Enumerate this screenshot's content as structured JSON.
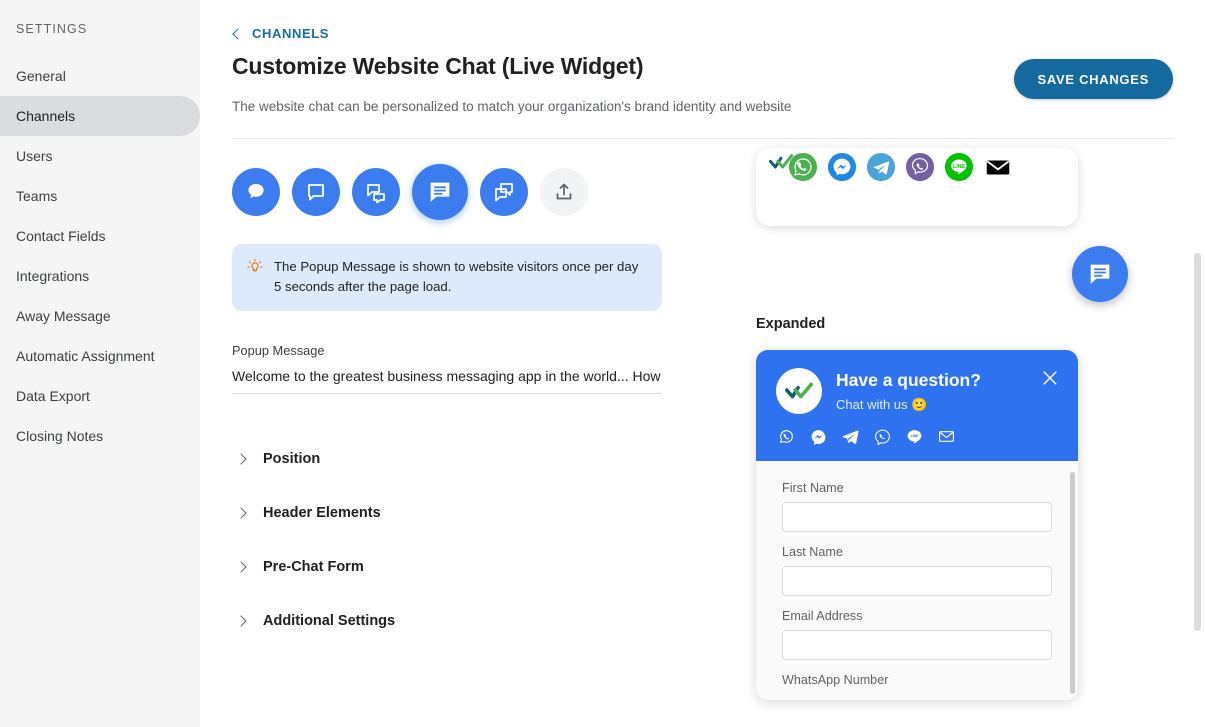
{
  "sidebar": {
    "title": "SETTINGS",
    "items": [
      {
        "label": "General",
        "active": false
      },
      {
        "label": "Channels",
        "active": true
      },
      {
        "label": "Users",
        "active": false
      },
      {
        "label": "Teams",
        "active": false
      },
      {
        "label": "Contact Fields",
        "active": false
      },
      {
        "label": "Integrations",
        "active": false
      },
      {
        "label": "Away Message",
        "active": false
      },
      {
        "label": "Automatic Assignment",
        "active": false
      },
      {
        "label": "Data Export",
        "active": false
      },
      {
        "label": "Closing Notes",
        "active": false
      }
    ]
  },
  "header": {
    "breadcrumb_label": "CHANNELS",
    "breadcrumb_icon": "chevron-left-icon",
    "title": "Customize Website Chat (Live Widget)",
    "subtitle": "The website chat can be personalized to match your organization's brand identity and website",
    "save_label": "SAVE CHANGES",
    "accent_color": "#14699f",
    "link_color": "#1a6e9e"
  },
  "icon_picker": {
    "options": [
      {
        "name": "chat-bubble-round-icon",
        "selected": false
      },
      {
        "name": "chat-bubble-square-icon",
        "selected": false
      },
      {
        "name": "chat-bubbles-double-icon",
        "selected": false
      },
      {
        "name": "chat-bubble-lines-icon",
        "selected": true
      },
      {
        "name": "chat-bubble-overlap-icon",
        "selected": false
      },
      {
        "name": "upload-icon",
        "selected": false
      }
    ],
    "active_color": "#3b7dee"
  },
  "info_banner": {
    "icon": "lightbulb-icon",
    "text": "The Popup Message is shown to website visitors once per day 5 seconds after the page load.",
    "bg_color": "#ddeafc"
  },
  "popup_message": {
    "label": "Popup Message",
    "value": "Welcome to the greatest business messaging app in the world... How can I"
  },
  "accordions": [
    {
      "label": "Position",
      "icon": "chevron-right-icon",
      "expanded": false
    },
    {
      "label": "Header Elements",
      "icon": "chevron-right-icon",
      "expanded": false
    },
    {
      "label": "Pre-Chat Form",
      "icon": "chevron-right-icon",
      "expanded": false
    },
    {
      "label": "Additional Settings",
      "icon": "chevron-right-icon",
      "expanded": false
    }
  ],
  "preview": {
    "collapsed_card": {
      "socials": [
        {
          "name": "whatsapp-icon",
          "color": "#4CAF50"
        },
        {
          "name": "messenger-icon",
          "color": "#1E88E5"
        },
        {
          "name": "telegram-icon",
          "color": "#4BA3DC"
        },
        {
          "name": "viber-icon",
          "color": "#7360A0"
        },
        {
          "name": "line-icon",
          "color": "#00C300"
        },
        {
          "name": "email-icon",
          "color": "#000000"
        }
      ]
    },
    "fab": {
      "name": "chat-bubble-lines-icon",
      "color": "#3b7dee"
    },
    "expanded_label": "Expanded",
    "widget": {
      "header_color": "#2f72f0",
      "title": "Have a question?",
      "subtitle": "Chat with us 🙂",
      "close_icon": "close-icon",
      "logo_icon": "double-check-logo-icon",
      "socials": [
        {
          "name": "whatsapp-icon"
        },
        {
          "name": "messenger-icon"
        },
        {
          "name": "telegram-icon"
        },
        {
          "name": "viber-icon"
        },
        {
          "name": "line-icon"
        },
        {
          "name": "email-icon"
        }
      ],
      "fields": [
        {
          "label": "First Name",
          "value": ""
        },
        {
          "label": "Last Name",
          "value": ""
        },
        {
          "label": "Email Address",
          "value": ""
        },
        {
          "label": "WhatsApp Number",
          "value": ""
        }
      ]
    }
  }
}
